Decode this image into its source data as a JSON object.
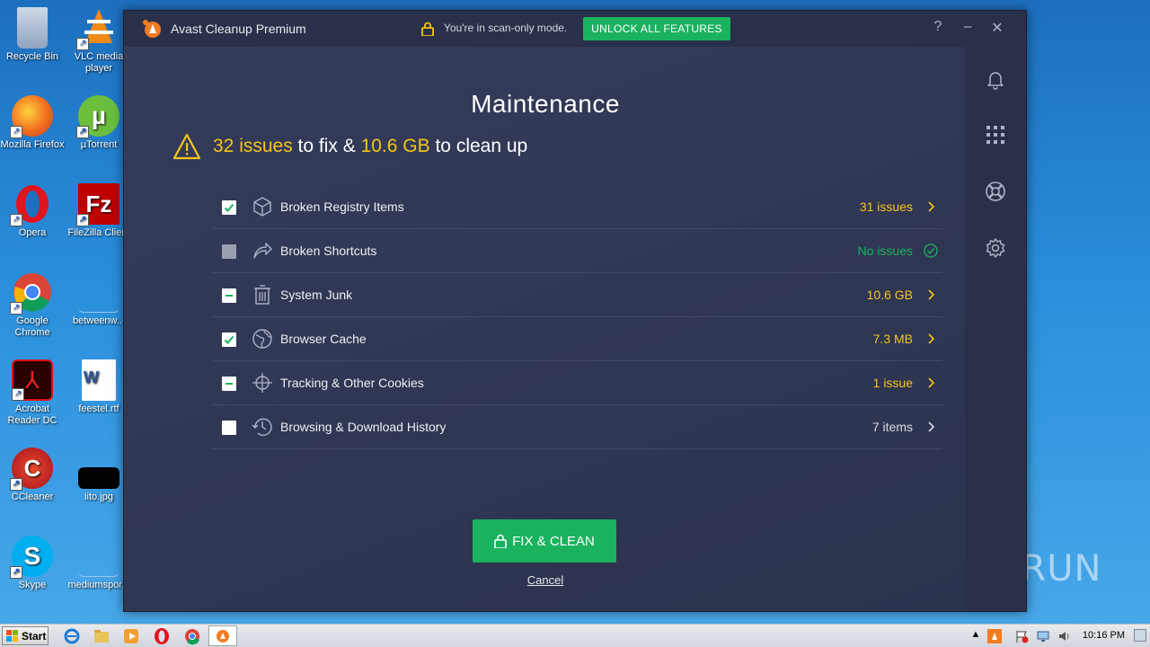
{
  "desktop": {
    "icons": [
      {
        "label": "Recycle Bin"
      },
      {
        "label": "VLC media player"
      },
      {
        "label": "Mozilla Firefox"
      },
      {
        "label": "µTorrent"
      },
      {
        "label": "Opera"
      },
      {
        "label": "FileZilla Client"
      },
      {
        "label": "Google Chrome"
      },
      {
        "label": "betweenw..."
      },
      {
        "label": "Acrobat Reader DC"
      },
      {
        "label": "feestel.rtf"
      },
      {
        "label": "CCleaner"
      },
      {
        "label": "iito.jpg"
      },
      {
        "label": "Skype"
      },
      {
        "label": "mediumspor..."
      }
    ]
  },
  "window": {
    "title": "Avast Cleanup Premium",
    "scan_mode_text": "You're in scan-only mode.",
    "unlock_label": "UNLOCK ALL FEATURES",
    "help_label": "?",
    "minimize_label": "–",
    "close_label": "✕"
  },
  "main": {
    "title": "Maintenance",
    "summary": {
      "issues": "32 issues",
      "mid": " to fix & ",
      "size": "10.6 GB",
      "tail": " to clean up"
    },
    "items": [
      {
        "label": "Broken Registry Items",
        "value": "31 issues",
        "state": "checked"
      },
      {
        "label": "Broken Shortcuts",
        "value": "No issues",
        "state": "disabled"
      },
      {
        "label": "System Junk",
        "value": "10.6 GB",
        "state": "partial"
      },
      {
        "label": "Browser Cache",
        "value": "7.3 MB",
        "state": "checked"
      },
      {
        "label": "Tracking & Other Cookies",
        "value": "1 issue",
        "state": "partial"
      },
      {
        "label": "Browsing & Download History",
        "value": "7 items",
        "state": "unchecked"
      }
    ],
    "fix_label": "FIX & CLEAN",
    "cancel_label": "Cancel"
  },
  "watermark": "ANY RUN",
  "taskbar": {
    "start_label": "Start",
    "time": "10:16 PM"
  },
  "colors": {
    "accent_green": "#1bb25f",
    "highlight_yellow": "#f5c518",
    "window_bg": "#2f3651"
  }
}
